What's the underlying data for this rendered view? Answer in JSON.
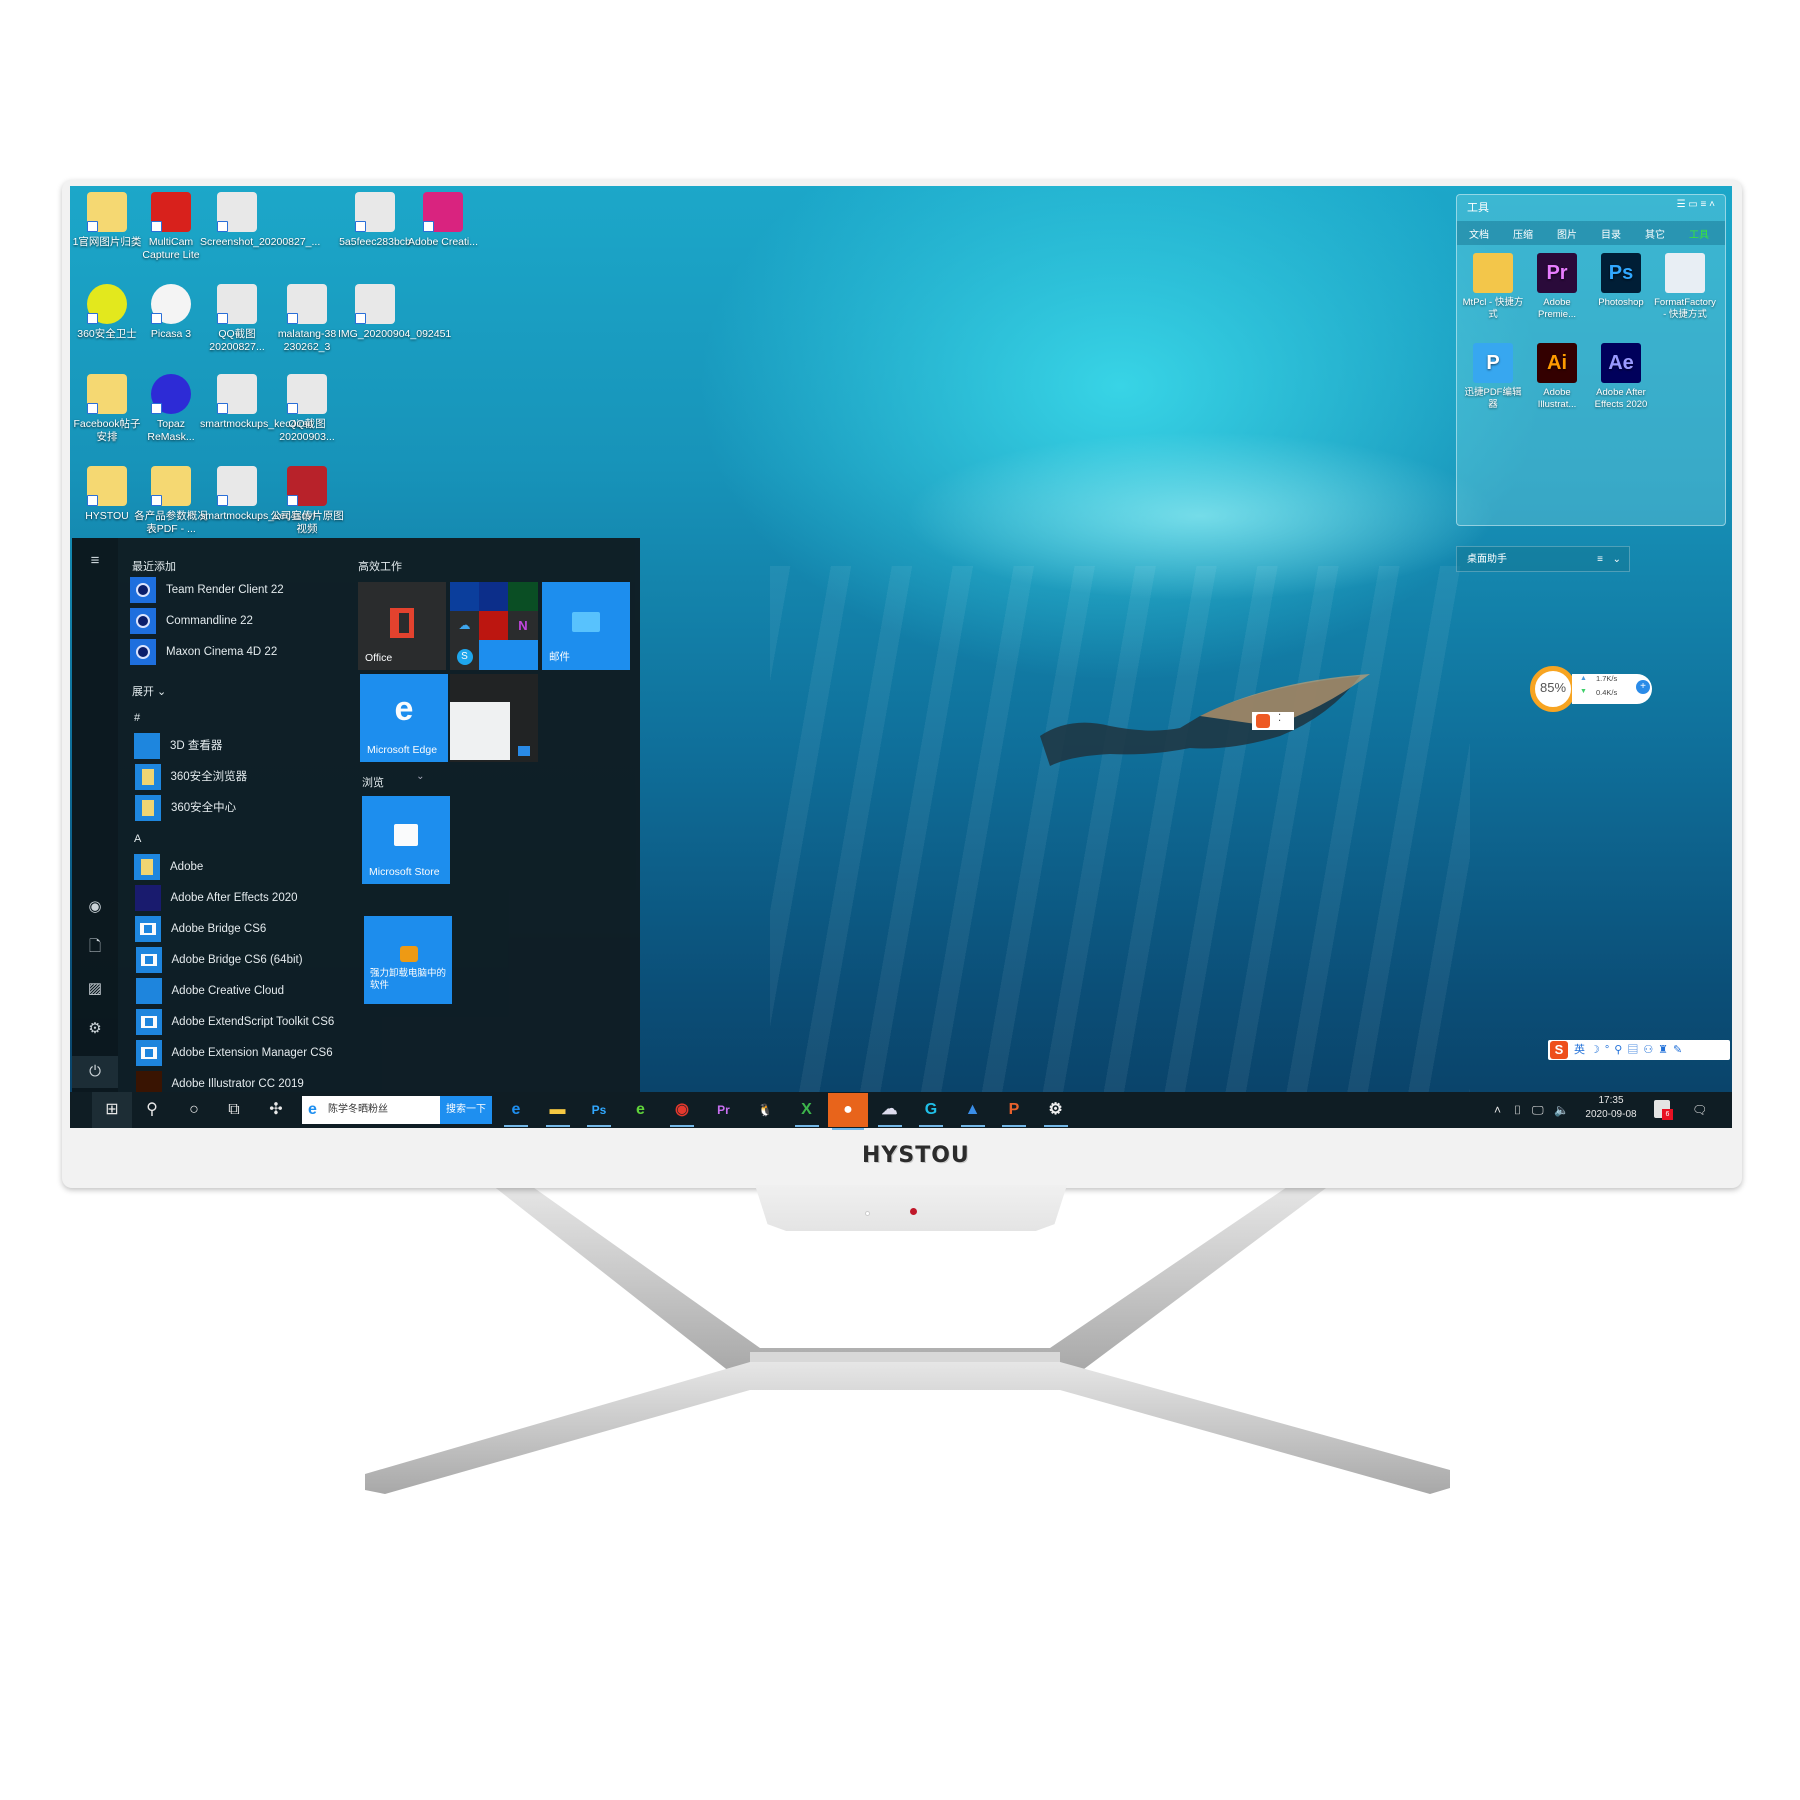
{
  "desktop": {
    "icons": [
      {
        "label": "1官网图片归类",
        "icon": "folder-icon"
      },
      {
        "label": "MultiCam Capture Lite",
        "icon": "multicam-icon"
      },
      {
        "label": "Screenshot_20200827_...",
        "icon": "image-file-icon"
      },
      {
        "label": "5a5feec283bcb",
        "icon": "image-file-icon"
      },
      {
        "label": "Adobe Creati...",
        "icon": "creative-cloud-icon"
      },
      {
        "label": "360安全卫士",
        "icon": "360-security-icon"
      },
      {
        "label": "Picasa 3",
        "icon": "picasa-icon"
      },
      {
        "label": "QQ截图20200827...",
        "icon": "image-file-icon"
      },
      {
        "label": "malatang-38 230262_3",
        "icon": "image-file-icon"
      },
      {
        "label": "IMG_20200904_092451",
        "icon": "image-file-icon"
      },
      {
        "label": "Facebook帖子安排",
        "icon": "folder-icon"
      },
      {
        "label": "Topaz ReMask...",
        "icon": "topaz-icon"
      },
      {
        "label": "smartmockups_kec4irs4",
        "icon": "image-file-icon"
      },
      {
        "label": "QQ截图20200903...",
        "icon": "image-file-icon"
      },
      {
        "label": "HYSTOU",
        "icon": "user-folder-icon"
      },
      {
        "label": "各产品参数概况表PDF - ...",
        "icon": "folder-icon"
      },
      {
        "label": "smartmockups_kec4sqvf",
        "icon": "image-file-icon"
      },
      {
        "label": "公司宣传片原图视频",
        "icon": "winrar-icon"
      }
    ]
  },
  "start_menu": {
    "recent_header": "最近添加",
    "recent": [
      {
        "label": "Team Render Client 22"
      },
      {
        "label": "Commandline 22"
      },
      {
        "label": "Maxon Cinema 4D 22"
      }
    ],
    "expand_label": "展开",
    "groups": [
      {
        "letter": "#",
        "items": [
          {
            "label": "3D 查看器",
            "expandable": false
          },
          {
            "label": "360安全浏览器",
            "expandable": true
          },
          {
            "label": "360安全中心",
            "expandable": true
          }
        ]
      },
      {
        "letter": "A",
        "items": [
          {
            "label": "Adobe",
            "expandable": true
          },
          {
            "label": "Adobe After Effects 2020",
            "expandable": false
          },
          {
            "label": "Adobe Bridge CS6",
            "expandable": false
          },
          {
            "label": "Adobe Bridge CS6 (64bit)",
            "expandable": false
          },
          {
            "label": "Adobe Creative Cloud",
            "expandable": false
          },
          {
            "label": "Adobe ExtendScript Toolkit CS6",
            "expandable": false
          },
          {
            "label": "Adobe Extension Manager CS6",
            "expandable": false
          },
          {
            "label": "Adobe Illustrator CC 2019",
            "expandable": false
          }
        ]
      }
    ],
    "tiles_header_work": "高效工作",
    "tiles_header_browse": "浏览",
    "tiles": {
      "office": "Office",
      "mail": "邮件",
      "edge": "Microsoft Edge",
      "store": "Microsoft Store",
      "uninstall": "强力卸载电脑中的软件"
    }
  },
  "taskbar": {
    "search_text": "陈学冬晒粉丝",
    "search_button": "搜索一下",
    "time": "17:35",
    "date": "2020-09-08",
    "notification_badge": "6"
  },
  "toolbox": {
    "title": "工具",
    "tabs": [
      "文档",
      "压缩",
      "图片",
      "目录",
      "其它",
      "工具"
    ],
    "active_tab": "工具",
    "icons": [
      {
        "label": "MtPcl - 快捷方式",
        "glyph": ""
      },
      {
        "label": "Adobe Premie...",
        "glyph": "Pr"
      },
      {
        "label": "Photoshop",
        "glyph": "Ps"
      },
      {
        "label": "FormatFactory - 快捷方式",
        "glyph": ""
      },
      {
        "label": "迅捷PDF编辑器",
        "glyph": "P"
      },
      {
        "label": "Adobe Illustrat...",
        "glyph": "Ai"
      },
      {
        "label": "Adobe After Effects 2020",
        "glyph": "Ae"
      }
    ]
  },
  "desktop_assistant": {
    "label": "桌面助手"
  },
  "net_widget": {
    "percent": "85%",
    "up": "1.7K/s",
    "down": "0.4K/s"
  },
  "brand": {
    "name": "HYSTOU"
  },
  "colors": {
    "accent": "#1e8ff0",
    "start_bg": "#0f1e25",
    "taskbar_bg": "#0f1d24",
    "toolbox_active": "#39e639"
  }
}
